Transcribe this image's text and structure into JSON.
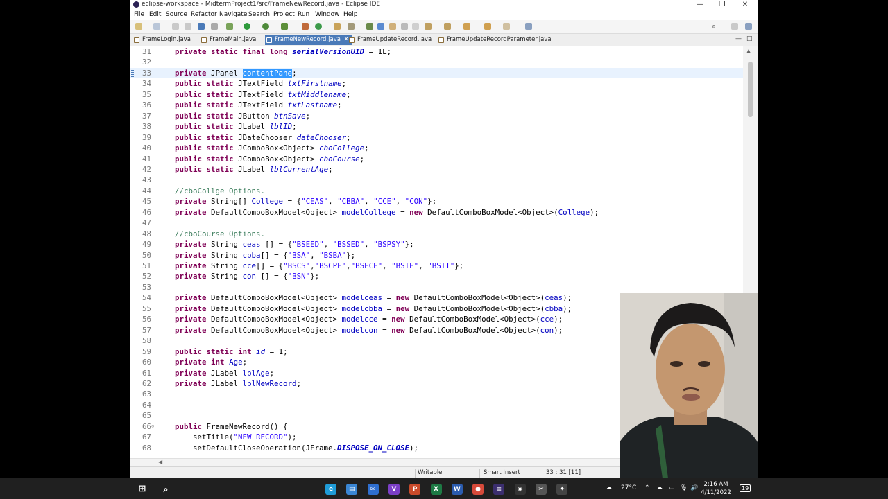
{
  "window": {
    "title": "eclipse-workspace - MidtermProject1/src/FrameNewRecord.java - Eclipse IDE",
    "minimize": "—",
    "maximize": "❐",
    "close": "✕"
  },
  "menu": [
    "File",
    "Edit",
    "Source",
    "Refactor",
    "Navigate",
    "Search",
    "Project",
    "Run",
    "Window",
    "Help"
  ],
  "tabs": [
    {
      "label": "FrameLogin.java",
      "active": false
    },
    {
      "label": "FrameMain.java",
      "active": false
    },
    {
      "label": "FrameNewRecord.java",
      "active": true
    },
    {
      "label": "FrameUpdateRecord.java",
      "active": false
    },
    {
      "label": "FrameUpdateRecordParameter.java",
      "active": false
    }
  ],
  "tab_close": "✕",
  "view_controls": {
    "minimize": "—",
    "maximize": "□"
  },
  "editor": {
    "lines": [
      {
        "n": "31",
        "code": "    private static final long serialVersionUID = 1L;"
      },
      {
        "n": "32",
        "code": ""
      },
      {
        "n": "33",
        "code": "    private JPanel contentPane;"
      },
      {
        "n": "34",
        "code": "    public static JTextField txtFirstname;"
      },
      {
        "n": "35",
        "code": "    public static JTextField txtMiddlename;"
      },
      {
        "n": "36",
        "code": "    public static JTextField txtLastname;"
      },
      {
        "n": "37",
        "code": "    public static JButton btnSave;"
      },
      {
        "n": "38",
        "code": "    public static JLabel lblID;"
      },
      {
        "n": "39",
        "code": "    public static JDateChooser dateChooser;"
      },
      {
        "n": "40",
        "code": "    public static JComboBox<Object> cboCollege;"
      },
      {
        "n": "41",
        "code": "    public static JComboBox<Object> cboCourse;"
      },
      {
        "n": "42",
        "code": "    public static JLabel lblCurrentAge;"
      },
      {
        "n": "43",
        "code": ""
      },
      {
        "n": "44",
        "code": "    //cboCollge Options."
      },
      {
        "n": "45",
        "code": "    private String[] College = {\"CEAS\", \"CBBA\", \"CCE\", \"CON\"};"
      },
      {
        "n": "46",
        "code": "    private DefaultComboBoxModel<Object> modelCollege = new DefaultComboBoxModel<Object>(College);"
      },
      {
        "n": "47",
        "code": ""
      },
      {
        "n": "48",
        "code": "    //cboCourse Options."
      },
      {
        "n": "49",
        "code": "    private String ceas [] = {\"BSEED\", \"BSSED\", \"BSPSY\"};"
      },
      {
        "n": "50",
        "code": "    private String cbba[] = {\"BSA\", \"BSBA\"};"
      },
      {
        "n": "51",
        "code": "    private String cce[] = {\"BSCS\",\"BSCPE\",\"BSECE\", \"BSIE\", \"BSIT\"};"
      },
      {
        "n": "52",
        "code": "    private String con [] = {\"BSN\"};"
      },
      {
        "n": "53",
        "code": ""
      },
      {
        "n": "54",
        "code": "    private DefaultComboBoxModel<Object> modelceas = new DefaultComboBoxModel<Object>(ceas);"
      },
      {
        "n": "55",
        "code": "    private DefaultComboBoxModel<Object> modelcbba = new DefaultComboBoxModel<Object>(cbba);"
      },
      {
        "n": "56",
        "code": "    private DefaultComboBoxModel<Object> modelcce = new DefaultComboBoxModel<Object>(cce);"
      },
      {
        "n": "57",
        "code": "    private DefaultComboBoxModel<Object> modelcon = new DefaultComboBoxModel<Object>(con);"
      },
      {
        "n": "58",
        "code": ""
      },
      {
        "n": "59",
        "code": "    public static int id = 1;"
      },
      {
        "n": "60",
        "code": "    private int Age;"
      },
      {
        "n": "61",
        "code": "    private JLabel lblAge;"
      },
      {
        "n": "62",
        "code": "    private JLabel lblNewRecord;"
      },
      {
        "n": "63",
        "code": ""
      },
      {
        "n": "64",
        "code": ""
      },
      {
        "n": "65",
        "code": ""
      },
      {
        "n": "66",
        "code": "    public FrameNewRecord() {"
      },
      {
        "n": "67",
        "code": "        setTitle(\"NEW RECORD\");"
      },
      {
        "n": "68",
        "code": "        setDefaultCloseOperation(JFrame.DISPOSE_ON_CLOSE);"
      }
    ],
    "fold_marker": "⊖"
  },
  "statusbar": {
    "mode": "Writable",
    "insert": "Smart Insert",
    "position": "33 : 31 [11]"
  },
  "taskbar": {
    "weather": "27°C",
    "time": "2:16 AM",
    "date": "4/11/2022",
    "notifications": "19",
    "app_icons": [
      {
        "name": "edge",
        "color": "#1f9cd8",
        "glyph": "e"
      },
      {
        "name": "store",
        "color": "#3a86d4",
        "glyph": "▤"
      },
      {
        "name": "mail",
        "color": "#2f6fcf",
        "glyph": "✉"
      },
      {
        "name": "visual-studio",
        "color": "#7b3fc6",
        "glyph": "V"
      },
      {
        "name": "powerpoint",
        "color": "#c94a2a",
        "glyph": "P"
      },
      {
        "name": "excel",
        "color": "#1e7a45",
        "glyph": "X"
      },
      {
        "name": "word",
        "color": "#2b5caf",
        "glyph": "W"
      },
      {
        "name": "chrome",
        "color": "#d64a3a",
        "glyph": "●"
      },
      {
        "name": "eclipse",
        "color": "#3b2e6e",
        "glyph": "≡"
      },
      {
        "name": "obs",
        "color": "#333333",
        "glyph": "◉"
      },
      {
        "name": "snipping",
        "color": "#555555",
        "glyph": "✂"
      },
      {
        "name": "app-x",
        "color": "#444444",
        "glyph": "✦"
      }
    ]
  },
  "syntax": {
    "keywords": [
      "private",
      "public",
      "static",
      "final",
      "long",
      "int",
      "new"
    ],
    "fields": [
      "College",
      "modelCollege",
      "ceas",
      "cbba",
      "cce",
      "con",
      "modelceas",
      "modelcbba",
      "modelcce",
      "modelcon",
      "Age",
      "lblAge",
      "lblNewRecord",
      "contentPane"
    ],
    "static_fields": [
      "txtFirstname",
      "txtMiddlename",
      "txtLastname",
      "btnSave",
      "lblID",
      "dateChooser",
      "cboCollege",
      "cboCourse",
      "lblCurrentAge",
      "id"
    ],
    "static_final_fields": [
      "serialVersionUID",
      "DISPOSE_ON_CLOSE"
    ],
    "selected_word": "contentPane",
    "current_line": "33",
    "marker_line": "33",
    "fold_lines": [
      "66"
    ]
  }
}
